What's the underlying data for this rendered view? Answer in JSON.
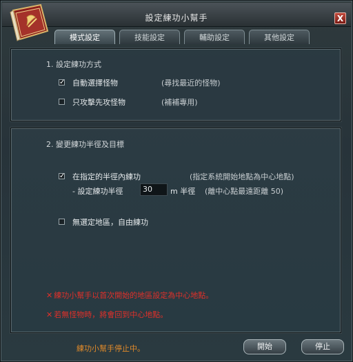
{
  "window": {
    "title": "設定練功小幫手",
    "close_glyph": "X"
  },
  "tabs": [
    {
      "label": "模式設定",
      "active": true
    },
    {
      "label": "技能設定",
      "active": false
    },
    {
      "label": "輔助設定",
      "active": false
    },
    {
      "label": "其他設定",
      "active": false
    }
  ],
  "section1": {
    "title": "1. 設定練功方式",
    "options": [
      {
        "label": "自動選擇怪物",
        "note": "(尋找最近的怪物)",
        "checked": true
      },
      {
        "label": "只攻擊先攻怪物",
        "note": "(補補專用)",
        "checked": false
      }
    ]
  },
  "section2": {
    "title": "2. 變更練功半徑及目標",
    "radius_option": {
      "label": "在指定的半徑內練功",
      "note": "(指定系統開始地點為中心地點)",
      "checked": true
    },
    "radius_label": "- 設定練功半徑",
    "radius_value": "30",
    "radius_unit": "m 半徑",
    "radius_note": "(離中心點最遠距離 50)",
    "free_option": {
      "label": "無選定地區，自由練功",
      "checked": false
    },
    "warnings": [
      "練功小幫手以首次開始的地區設定為中心地點。",
      "若無怪物時，將會回到中心地點。"
    ],
    "warning_glyph": "✕"
  },
  "footer": {
    "status": "練功小幫手停止中。",
    "start_label": "開始",
    "stop_label": "停止"
  },
  "glyphs": {
    "check": "✓"
  },
  "colors": {
    "warning": "#e0302a",
    "status": "#e08a2a"
  }
}
